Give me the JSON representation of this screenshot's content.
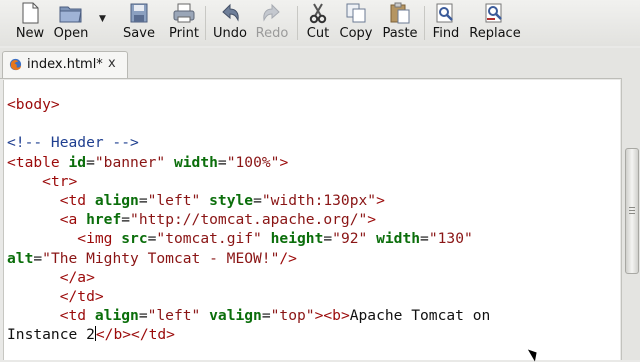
{
  "toolbar": {
    "new": "New",
    "open": "Open",
    "save": "Save",
    "print": "Print",
    "undo": "Undo",
    "redo": "Redo",
    "cut": "Cut",
    "copy": "Copy",
    "paste": "Paste",
    "find": "Find",
    "replace": "Replace"
  },
  "tab": {
    "title": "index.html*",
    "close": "x"
  },
  "code": {
    "line1": {
      "open": "<body>"
    },
    "line3": {
      "comment": "<!-- Header -->"
    },
    "line4": {
      "tag": "<table",
      "a1": "id",
      "eq1": "=",
      "v1": "\"banner\"",
      "a2": "width",
      "eq2": "=",
      "v2": "\"100%\"",
      "close": ">"
    },
    "line5": {
      "tag": "<tr>"
    },
    "line6": {
      "tag": "<td",
      "a1": "align",
      "eq1": "=",
      "v1": "\"left\"",
      "a2": "style",
      "eq2": "=",
      "v2": "\"width:130px\"",
      "close": ">"
    },
    "line7": {
      "tag": "<a",
      "a1": "href",
      "eq1": "=",
      "v1": "\"http://tomcat.apache.org/\"",
      "close": ">"
    },
    "line8": {
      "tag": "<img",
      "a1": "src",
      "eq1": "=",
      "v1": "\"tomcat.gif\"",
      "a2": "height",
      "eq2": "=",
      "v2": "\"92\"",
      "a3": "width",
      "eq3": "=",
      "v3": "\"130\""
    },
    "line9": {
      "a1": "alt",
      "eq1": "=",
      "v1": "\"The Mighty Tomcat - MEOW!\"",
      "close": "/>"
    },
    "line10": {
      "tag": "</a>"
    },
    "line11": {
      "tag": "</td>"
    },
    "line12": {
      "tag": "<td",
      "a1": "align",
      "eq1": "=",
      "v1": "\"left\"",
      "a2": "valign",
      "eq2": "=",
      "v2": "\"top\"",
      "close": ">",
      "b": "<b>",
      "text": "Apache Tomcat on"
    },
    "line13": {
      "text_a": "Instance 2",
      "close_b": "</b>",
      "close_td": "</td>"
    }
  },
  "colors": {
    "tag": "#9b0a0a",
    "attribute": "#0b6e0b",
    "value": "#8a1515",
    "comment": "#1f3f90"
  },
  "icons": [
    "new-document-icon",
    "open-folder-icon",
    "save-icon",
    "print-icon",
    "undo-icon",
    "redo-icon",
    "cut-icon",
    "copy-icon",
    "paste-icon",
    "find-icon",
    "replace-icon",
    "firefox-icon"
  ]
}
